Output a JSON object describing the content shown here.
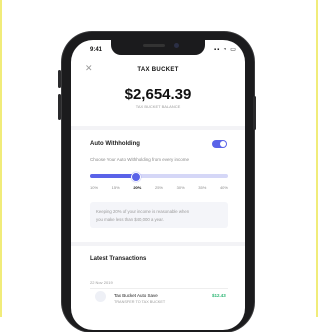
{
  "status_bar": {
    "time": "9:41",
    "icons": [
      "signal-icon",
      "wifi-icon",
      "battery-icon"
    ],
    "icons_text": "▪▪ ◔ ▭"
  },
  "screen": {
    "title": "TAX BUCKET",
    "close_icon": "close-icon",
    "balance": "$2,654.39",
    "balance_label": "TAX BUCKET BALANCE"
  },
  "auto_withholding": {
    "label": "Auto Withholding",
    "enabled": true,
    "subtitle": "Choose Your Auto Withholding from every income",
    "options": [
      "10%",
      "15%",
      "20%",
      "25%",
      "30%",
      "35%",
      "40%"
    ],
    "selected": "20%",
    "selected_index": 2,
    "note_line1": "Keeping 20% of your income is reasonable when",
    "note_line2": "you make less than $40,000 a year."
  },
  "transactions": {
    "heading": "Latest Transactions",
    "date": "22 Nov 2019",
    "items": [
      {
        "title": "Tax Bucket Auto Save",
        "subtitle": "TRANSFER TO TAX BUCKET",
        "amount": "$12.43"
      }
    ]
  },
  "colors": {
    "accent": "#5a63e8",
    "positive": "#2bb673",
    "edge": "#f1ec7a"
  }
}
